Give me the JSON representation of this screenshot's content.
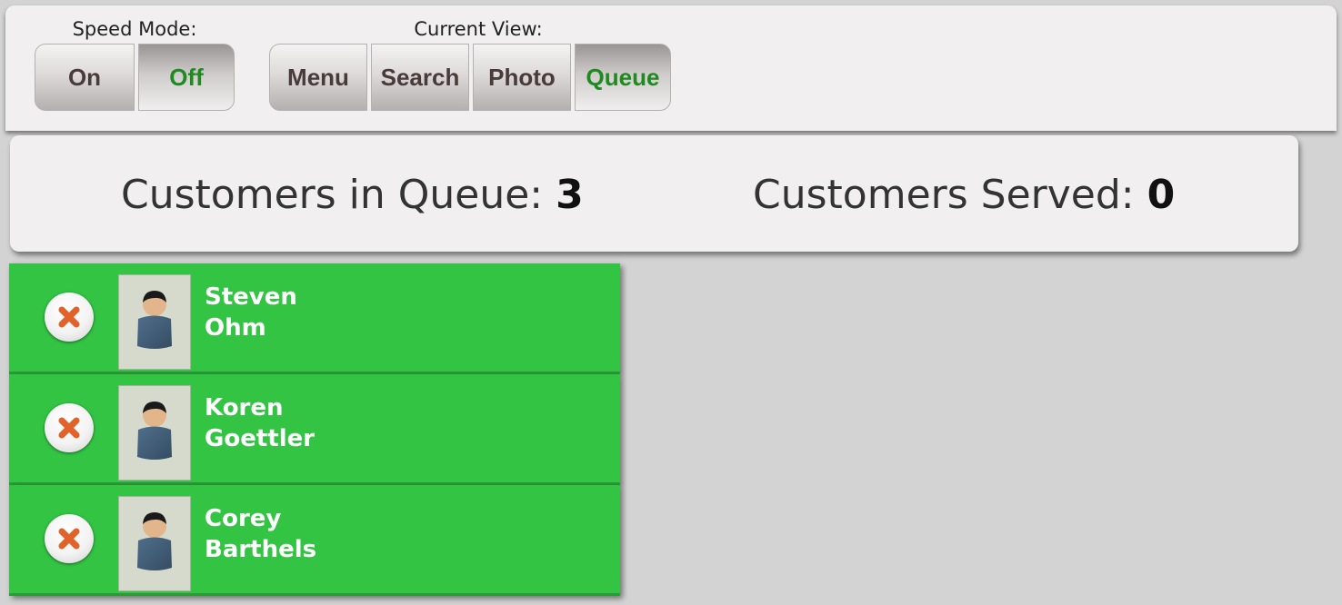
{
  "toolbar": {
    "speed_mode": {
      "label": "Speed Mode:",
      "options": [
        {
          "label": "On",
          "active": false
        },
        {
          "label": "Off",
          "active": true
        }
      ]
    },
    "current_view": {
      "label": "Current View:",
      "options": [
        {
          "label": "Menu",
          "active": false
        },
        {
          "label": "Search",
          "active": false
        },
        {
          "label": "Photo",
          "active": false
        },
        {
          "label": "Queue",
          "active": true
        }
      ]
    }
  },
  "stats": {
    "in_queue_label": "Customers in Queue:",
    "in_queue_value": "3",
    "served_label": "Customers Served:",
    "served_value": "0"
  },
  "queue": [
    {
      "first": "Steven",
      "last": "Ohm"
    },
    {
      "first": "Koren",
      "last": "Goettler"
    },
    {
      "first": "Corey",
      "last": "Barthels"
    }
  ],
  "colors": {
    "row_bg": "#33c444",
    "active_text": "#1f8a1f",
    "remove_x": "#e0632a"
  },
  "icons": {
    "remove": "close-circle-icon",
    "avatar": "person-icon"
  }
}
